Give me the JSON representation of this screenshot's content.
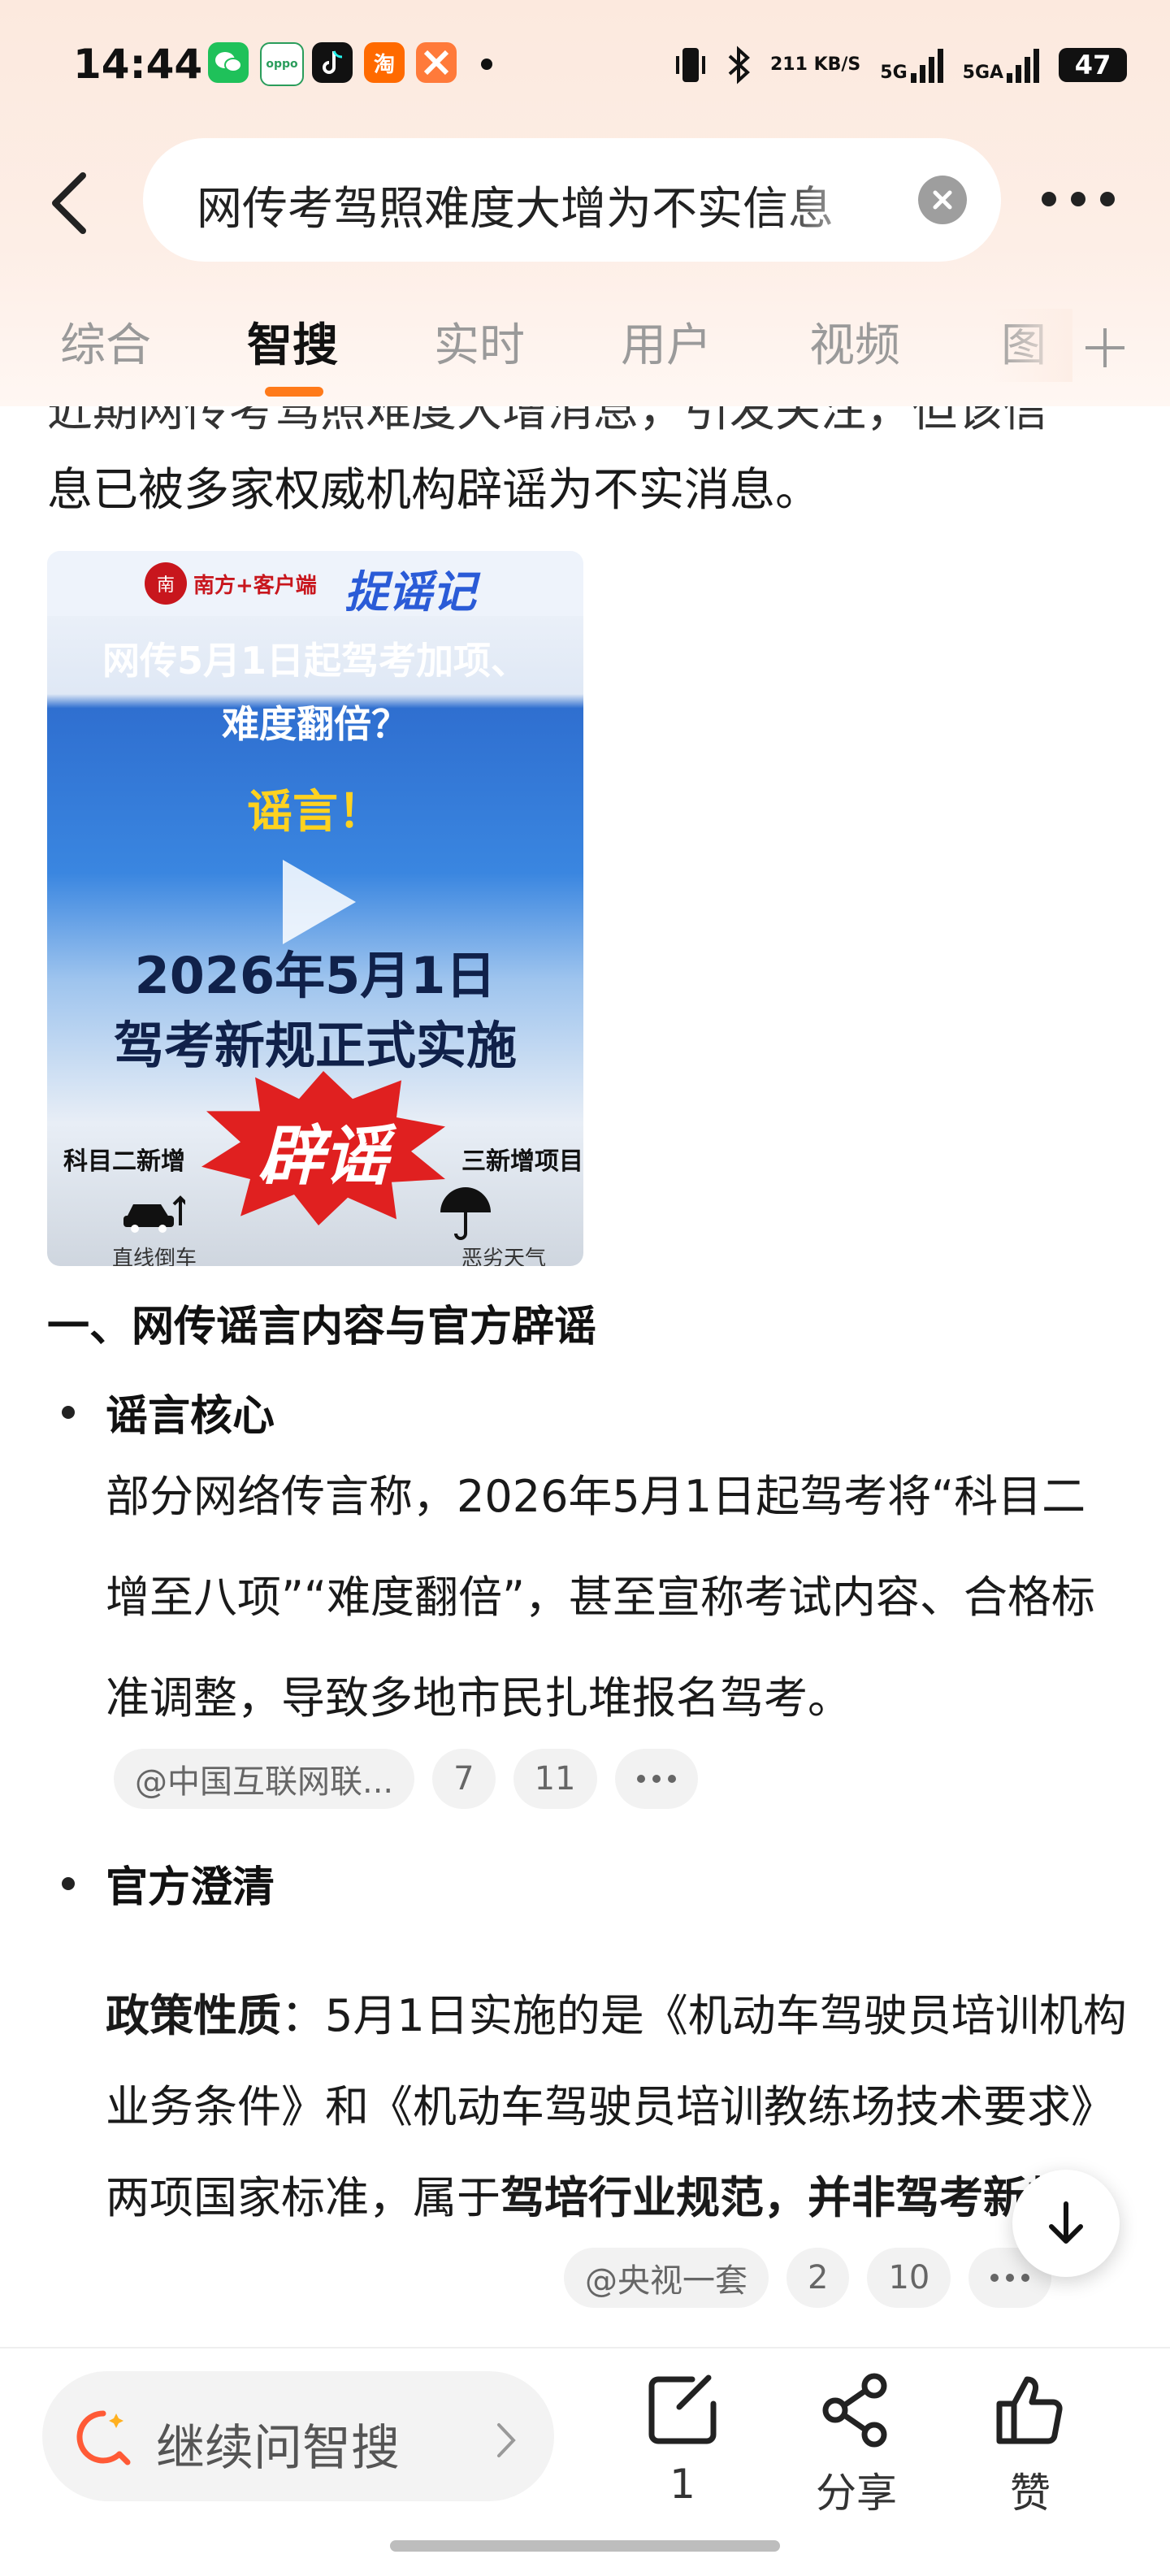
{
  "status_bar": {
    "time": "14:44",
    "app_icons": [
      "wechat-icon",
      "oppo-icon",
      "tiktok-icon",
      "taobao-icon",
      "app-icon"
    ],
    "net_speed": "211 KB/S",
    "signal1": "5G",
    "signal2": "5GA",
    "battery": "47"
  },
  "search": {
    "query": "网传考驾照难度大增为不实信息"
  },
  "tabs": [
    {
      "label": "综合"
    },
    {
      "label": "智搜"
    },
    {
      "label": "实时"
    },
    {
      "label": "用户"
    },
    {
      "label": "视频"
    },
    {
      "label": "图"
    }
  ],
  "article": {
    "cut_line": "近期网传考驾照难度大增消息，引发关注，但该信",
    "intro": "息已被多家权威机构辟谣为不实消息。",
    "video": {
      "outlet": "南方+客户端",
      "brand": "捉谣记",
      "title_line1": "网传5月1日起驾考加项、",
      "title_line2": "难度翻倍？",
      "verdict": "谣言！",
      "date_line1": "2026年5月1日",
      "date_line2": "驾考新规正式实施",
      "stamp": "辟谣",
      "left_caption": "科目二新增",
      "right_caption": "三新增项目",
      "left_foot": "直线倒车",
      "right_foot": "恶劣天气"
    },
    "section_heading": "一、网传谣言内容与官方辟谣",
    "bullet1": {
      "title": "谣言核心",
      "body": "部分网络传言称，2026年5月1日起驾考将“科目二增至八项”“难度翻倍”，甚至宣称考试内容、合格标准调整，导致多地市民扎堆报名驾考。",
      "source": "@中国互联网联...",
      "c1": "7",
      "c2": "11"
    },
    "bullet2": {
      "title": "官方澄清",
      "policy_label": "政策性质",
      "policy_body": "：5月1日实施的是《机动车驾驶员培训机构业务条件》和《机动车驾驶员培训教练场技术要求》两项国家标准，属于",
      "policy_bold": "驾培行业规范，并非驾考新规",
      "policy_end": "。",
      "source": "@央视一套",
      "c1": "2",
      "c2": "10"
    }
  },
  "bottom": {
    "ask_label": "继续问智搜",
    "comment_count": "1",
    "share_label": "分享",
    "like_label": "赞"
  },
  "colors": {
    "accent": "#ff7a1a",
    "header_bg": "#fdeee6"
  }
}
